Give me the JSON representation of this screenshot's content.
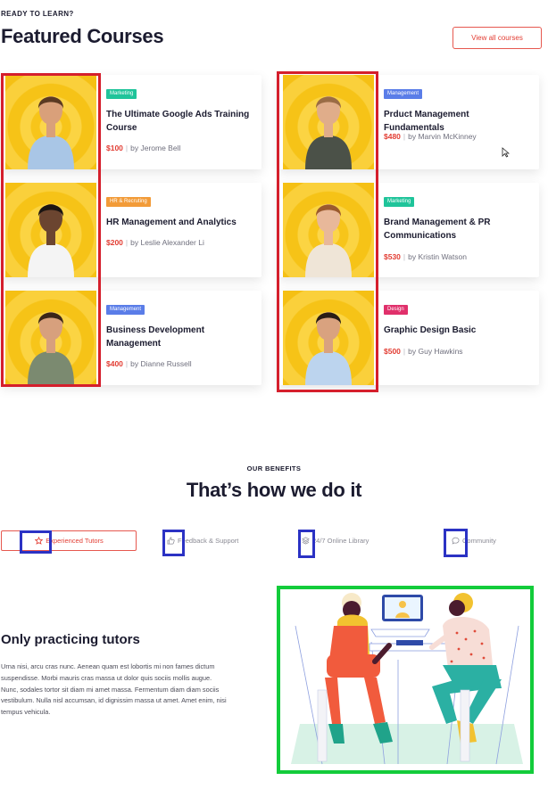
{
  "header": {
    "eyebrow": "READY TO LEARN?",
    "title": "Featured Courses",
    "view_all_label": "View all courses"
  },
  "courses": [
    {
      "tag": "Marketing",
      "tag_color": "#1fc49a",
      "title": "The Ultimate Google Ads Training Course",
      "price": "$100",
      "author": "by Jerome Bell",
      "shirt": "#a9c6e6",
      "hair": "#5b3a22",
      "skin": "#d9a07a"
    },
    {
      "tag": "HR & Recruting",
      "tag_color": "#f29b38",
      "title": "HR  Management and Analytics",
      "price": "$200",
      "author": "by Leslie Alexander Li",
      "shirt": "#f4f4f4",
      "hair": "#1b1512",
      "skin": "#6b4530"
    },
    {
      "tag": "Management",
      "tag_color": "#5a7de8",
      "title": "Business Development Management",
      "price": "$400",
      "author": "by Dianne Russell",
      "shirt": "#7b8a70",
      "hair": "#3b2519",
      "skin": "#d7a07d"
    },
    {
      "tag": "Management",
      "tag_color": "#5a7de8",
      "title": "Prduct Management Fundamentals",
      "price": "$480",
      "author": "by Marvin McKinney",
      "shirt": "#4b5148",
      "hair": "#9a6c45",
      "skin": "#e0ad8a"
    },
    {
      "tag": "Marketing",
      "tag_color": "#1fc49a",
      "title": "Brand Management & PR Communications",
      "price": "$530",
      "author": "by Kristin Watson",
      "shirt": "#efe5d7",
      "hair": "#9b5a2e",
      "skin": "#e8b89a"
    },
    {
      "tag": "Design",
      "tag_color": "#e0306b",
      "title": "Graphic Design Basic",
      "price": "$500",
      "author": "by Guy Hawkins",
      "shirt": "#bcd4ee",
      "hair": "#2a1d16",
      "skin": "#d9a27f"
    }
  ],
  "benefits": {
    "eyebrow": "OUR BENEFITS",
    "title": "That’s how we do it",
    "tabs": [
      {
        "label": "Experienced Tutors",
        "icon": "star-icon"
      },
      {
        "label": "Feedback & Support",
        "icon": "thumbs-up-icon"
      },
      {
        "label": "24/7 Online Library",
        "icon": "layers-icon"
      },
      {
        "label": "Community",
        "icon": "chat-bubble-icon"
      }
    ],
    "active_tab": "Experienced Tutors",
    "panel_title": "Only practicing tutors",
    "panel_text": "Urna nisi, arcu cras nunc. Aenean quam est lobortis mi non fames dictum suspendisse. Morbi mauris cras massa ut dolor quis sociis mollis augue. Nunc, sodales tortor sit diam mi amet massa. Fermentum diam diam sociis vestibulum. Nulla nisl accumsan, id dignissim massa ut amet. Amet enim, nisi tempus vehicula."
  },
  "colors": {
    "accent": "#e23d33",
    "annotation_red": "#d51f2c",
    "annotation_blue": "#2b32c4",
    "annotation_green": "#13cc3b",
    "thumb_yellow": "#f7c51a"
  }
}
